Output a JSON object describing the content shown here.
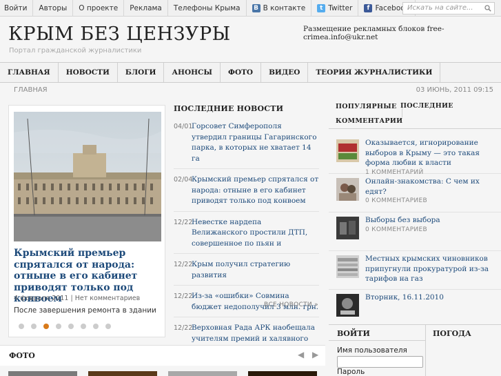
{
  "topnav": {
    "items": [
      "Войти",
      "Авторы",
      "О проекте",
      "Реклама",
      "Телефоны Крыма",
      "В контакте",
      "Twitter",
      "Facebook"
    ]
  },
  "search": {
    "placeholder": "Искать на сайте..."
  },
  "site": {
    "title": "КРЫМ БЕЗ ЦЕНЗУРЫ",
    "subtitle": "Портал гражданской журналистики",
    "ads": "Размещение рекламных блоков free-crimea.info@ukr.net"
  },
  "mainnav": {
    "items": [
      "ГЛАВНАЯ",
      "НОВОСТИ",
      "БЛОГИ",
      "АНОНСЫ",
      "ФОТО",
      "ВИДЕО",
      "ТЕОРИЯ ЖУРНАЛИСТИКИ"
    ]
  },
  "breadcrumb": "ГЛАВНАЯ",
  "date": "03 ИЮНЬ, 2011 09:15",
  "featured": {
    "title": "Крымский премьер спрятался от народа: отныне в его кабинет приводят только под конвоем",
    "date": "4 февраля 2011",
    "comments": "Нет комментариев",
    "excerpt": "После завершения ремонта в здании",
    "slides": 8,
    "active_slide": 2
  },
  "news": {
    "heading": "ПОСЛЕДНИЕ НОВОСТИ",
    "items": [
      {
        "date": "04/01",
        "title": "Горсовет Симферополя утвердил границы Гагаринского парка, в которых не хватает 14 га"
      },
      {
        "date": "02/04",
        "title": "Крымский премьер спрятался от народа: отныне в его кабинет приводят только под конвоем"
      },
      {
        "date": "12/22",
        "title": "Невестке нардепа Велижанского простили ДТП, совершенное по пьян и"
      },
      {
        "date": "12/22",
        "title": "Крым получил стратегию развития"
      },
      {
        "date": "12/22",
        "title": "Из-за «ошибки» Совмина бюджет недополучил 3 млн. грн."
      },
      {
        "date": "12/22",
        "title": "Верховная Рада АРК наобещала учителям премий и халявного жилья"
      }
    ],
    "all": "ВСЕ НОВОСТИ »"
  },
  "sidebar": {
    "tab_popular": "ПОПУЛЯРНЫЕ",
    "tab_latest": "ПОСЛЕДНИЕ",
    "tab_comments": "КОММЕНТАРИИ",
    "items": [
      {
        "title": "Оказывается, игнорирование выборов в Крыму — это такая форма любви к власти",
        "comments": "1 КОММЕНТАРИЙ",
        "thumb_color": "#c8a070"
      },
      {
        "title": "Онлайн-знакомства: С чем их едят?",
        "comments": "0 КОММЕНТАРИЕВ",
        "thumb_color": "#b8b8b8"
      },
      {
        "title": "Выборы без выбора",
        "comments": "0 КОММЕНТАРИЕВ",
        "thumb_color": "#505050"
      },
      {
        "title": "Местных крымских чиновников припугнули прокуратурой из-за тарифов на газ",
        "comments": "",
        "thumb_color": "#a0a0a0"
      },
      {
        "title": "Вторник, 16.11.2010",
        "comments": "",
        "thumb_color": "#404040"
      }
    ]
  },
  "bottom": {
    "foto": "ФОТО",
    "arrows": "◀ ▶",
    "login": "ВОЙТИ",
    "weather": "ПОГОДА",
    "username": "Имя пользователя",
    "password": "Пароль"
  }
}
